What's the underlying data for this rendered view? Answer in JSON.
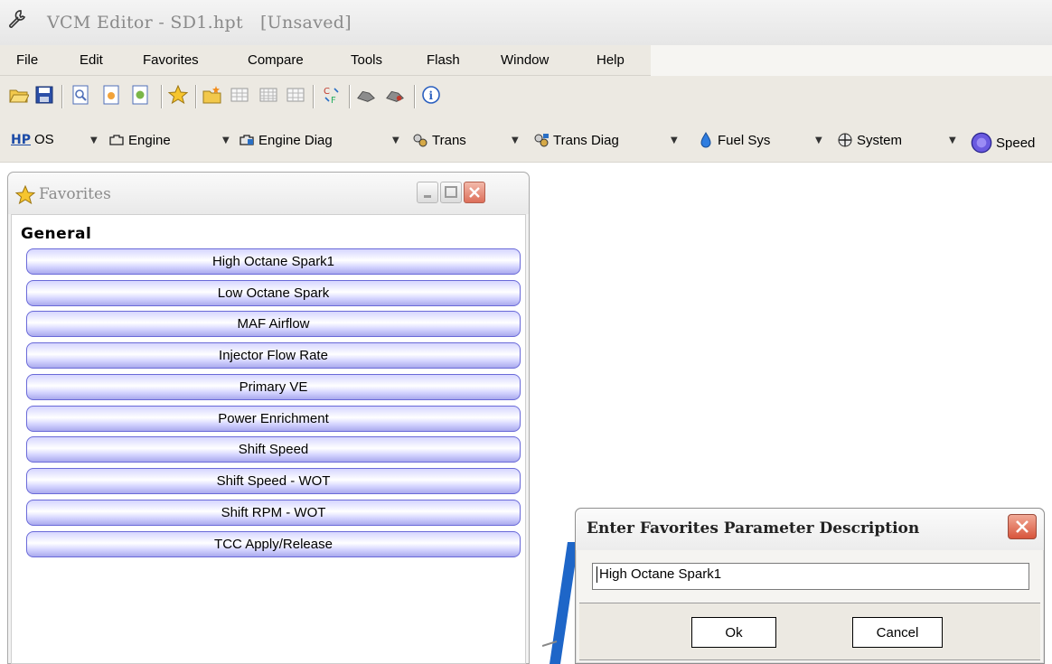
{
  "window": {
    "title": "VCM Editor - SD1.hpt   [Unsaved]",
    "icon": "wrench-icon"
  },
  "menu": {
    "items": [
      "File",
      "Edit",
      "Favorites",
      "Compare",
      "Tools",
      "Flash",
      "Window",
      "Help"
    ]
  },
  "toolbar1": {
    "icons": [
      "open-folder-icon",
      "save-icon",
      "preview-icon",
      "document-icon",
      "document-edit-icon",
      "favorites-star-icon",
      "new-folder-icon",
      "table-icon",
      "table-grid-icon",
      "table-data-icon",
      "compare-icon",
      "read-vehicle-icon",
      "write-vehicle-icon",
      "info-icon"
    ]
  },
  "toolbar2": {
    "hp_label": "HP",
    "items": [
      {
        "label": "OS",
        "icon": "hp-logo-icon"
      },
      {
        "label": "Engine",
        "icon": "engine-icon"
      },
      {
        "label": "Engine Diag",
        "icon": "engine-diag-icon"
      },
      {
        "label": "Trans",
        "icon": "trans-gears-icon"
      },
      {
        "label": "Trans Diag",
        "icon": "trans-diag-icon"
      },
      {
        "label": "Fuel Sys",
        "icon": "fuel-drop-icon"
      },
      {
        "label": "System",
        "icon": "system-icon"
      },
      {
        "label": "Speed",
        "icon": "speedo-icon"
      }
    ]
  },
  "favorites_panel": {
    "title": "Favorites",
    "group": "General",
    "items": [
      "High Octane Spark1",
      "Low Octane Spark",
      "MAF Airflow",
      "Injector Flow Rate",
      "Primary VE",
      "Power Enrichment",
      "Shift Speed",
      "Shift Speed - WOT",
      "Shift RPM - WOT",
      "TCC Apply/Release"
    ]
  },
  "dialog": {
    "title": "Enter Favorites Parameter Description",
    "input_value": "High Octane Spark1",
    "ok_label": "Ok",
    "cancel_label": "Cancel"
  },
  "colors": {
    "chrome": "#ece9e2",
    "button_border": "#6a6ad8",
    "close_red": "#d8553c"
  }
}
